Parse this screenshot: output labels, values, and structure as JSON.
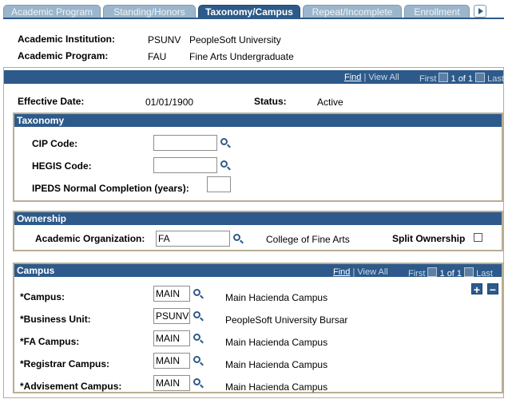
{
  "tabs": [
    {
      "label": "Academic Program",
      "active": false
    },
    {
      "label": "Standing/Honors",
      "active": false
    },
    {
      "label": "Taxonomy/Campus",
      "active": true
    },
    {
      "label": "Repeat/Incomplete",
      "active": false
    },
    {
      "label": "Enrollment",
      "active": false
    }
  ],
  "header": {
    "institution_label": "Academic Institution:",
    "institution_code": "PSUNV",
    "institution_name": "PeopleSoft University",
    "program_label": "Academic Program:",
    "program_code": "FAU",
    "program_name": "Fine Arts Undergraduate"
  },
  "nav_top": {
    "find": "Find",
    "view_all": "View All",
    "first": "First",
    "page": "1 of 1",
    "last": "Last"
  },
  "effective": {
    "date_label": "Effective Date:",
    "date_value": "01/01/1900",
    "status_label": "Status:",
    "status_value": "Active"
  },
  "taxonomy": {
    "title": "Taxonomy",
    "cip_label": "CIP Code:",
    "cip_value": "",
    "hegis_label": "HEGIS Code:",
    "hegis_value": "",
    "ipeds_label": "IPEDS Normal Completion (years):",
    "ipeds_value": ""
  },
  "ownership": {
    "title": "Ownership",
    "org_label": "Academic Organization:",
    "org_value": "FA",
    "org_desc": "College of Fine Arts",
    "split_label": "Split Ownership",
    "split_checked": false
  },
  "campus": {
    "title": "Campus",
    "nav": {
      "find": "Find",
      "view_all": "View All",
      "first": "First",
      "page": "1 of 1",
      "last": "Last"
    },
    "add": "+",
    "remove": "−",
    "rows": [
      {
        "label": "*Campus:",
        "value": "MAIN",
        "desc": "Main Hacienda Campus"
      },
      {
        "label": "*Business Unit:",
        "value": "PSUNV",
        "desc": "PeopleSoft University Bursar"
      },
      {
        "label": "*FA Campus:",
        "value": "MAIN",
        "desc": "Main Hacienda Campus"
      },
      {
        "label": "*Registrar Campus:",
        "value": "MAIN",
        "desc": "Main Hacienda Campus"
      },
      {
        "label": "*Advisement Campus:",
        "value": "MAIN",
        "desc": "Main Hacienda Campus"
      }
    ]
  },
  "colors": {
    "accent": "#2d5a8a",
    "tab_inactive": "#9bb6cc",
    "border": "#b9ad93"
  }
}
